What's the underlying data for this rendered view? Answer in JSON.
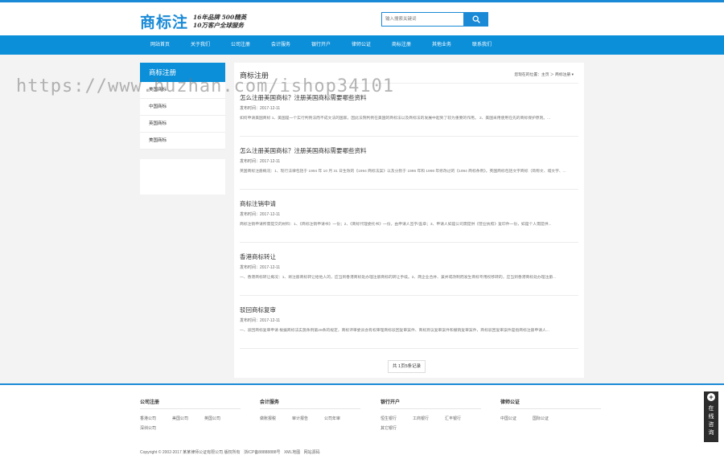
{
  "header": {
    "logo_text": "商标注",
    "slogan_line1": "16年品牌 500精英",
    "slogan_line2": "10万客户全球服务",
    "search_placeholder": "输入搜索关键词"
  },
  "nav": {
    "items": [
      "网站首页",
      "关于我们",
      "公司注册",
      "会计服务",
      "银行开户",
      "律师公证",
      "商标注册",
      "其他业务",
      "联系我们"
    ]
  },
  "watermark": "https://www.huzhan.com/ishop34101",
  "sidebar": {
    "title": "商标注册",
    "items": [
      "美国商标",
      "中国商标",
      "英国商标",
      "美国商标"
    ]
  },
  "main": {
    "title": "商标注册",
    "breadcrumb": {
      "prefix": "您现在的位置：",
      "home": "主页",
      "sep": "＞",
      "current": "商标注册"
    },
    "articles": [
      {
        "title": "怎么注册美国商标？注册美国商标需要哪些资料",
        "date": "发布时间：2017-12-11",
        "summary": "如何申请美国商标 1、美国是一个实行判例法而不成文法的国家，因此法院判例在美国的商标法以及商标法的发展中起到了较为重要的作用。 2、美国采用使用在先的商标保护原则。..."
      },
      {
        "title": "怎么注册美国商标？注册美国商标需要哪些资料",
        "date": "发布时间：2017-12-11",
        "summary": "英国商标注册概况：1、现行法律包括于 1994 年 10 月 31 日生效的《1994 商标法案》以及分别于 1996 年和 1998 年修改过的《1994 商标条例》。英国商标包括文字商标（简称文、城文字、..."
      },
      {
        "title": "商标注销申请",
        "date": "发布时间：2017-12-11",
        "summary": "商标注销申请所需提交的材料：1、《商标注销申请书》一份；2、《商标代理委托书》一份，由申请人签字/盖章；3、申请人如是公司需提供《营业执照》复印件一份，如是个人需提供..."
      },
      {
        "title": "香港商标转让",
        "date": "发布时间：2017-12-11",
        "summary": "一、香港商标转让概况：1、将注册商标转让给他人的，应当到香港商标处办理注册商标的转让手续。2、两企业合并、兼并或改制而发生商标专用权移转的，应当到香港商标处办理注册..."
      },
      {
        "title": "驳回商标复审",
        "date": "发布时间：2017-12-11",
        "summary": "一、驳回商标复审申请 根据商标法实施条例第28条的规定，商标评审委员会有权审理商标驳回复审案件、商标异议复审案件和撤销复审案件，商标驳回复审案件是指商标注册申请人..."
      }
    ],
    "pager": "共 1页5条记录"
  },
  "footer": {
    "columns": [
      {
        "title": "公司注册",
        "links": [
          "香港公司",
          "美国公司",
          "英国公司",
          "深圳公司"
        ]
      },
      {
        "title": "会计服务",
        "links": [
          "做账报税",
          "审计报告",
          "公司年审"
        ]
      },
      {
        "title": "银行开户",
        "links": [
          "恒生银行",
          "工商银行",
          "汇丰银行",
          "其它银行"
        ]
      },
      {
        "title": "律师公证",
        "links": [
          "中国公证",
          "国际公证"
        ]
      }
    ],
    "copyright": "Copyright © 2002-2017 某某律师公证有限公司 版权所有",
    "icp": "浙ICP备88888888号",
    "links": [
      "XML地图",
      "网站源码"
    ]
  },
  "consult": {
    "plus": "+",
    "text": "在线咨询"
  },
  "colors": {
    "brand_blue": "#0b8fd9",
    "accent_blue": "#1a8ad6"
  }
}
